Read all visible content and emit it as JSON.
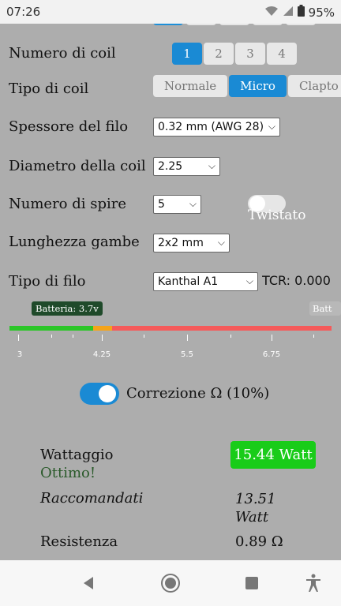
{
  "status": {
    "time": "07:26",
    "battery": "95%"
  },
  "coil_count": {
    "label": "Numero di coil",
    "options": [
      "1",
      "2",
      "3",
      "4"
    ],
    "selected": "1"
  },
  "coil_type": {
    "label": "Tipo di coil",
    "options": [
      "Normale",
      "Micro",
      "Clapto"
    ],
    "selected": "Micro"
  },
  "wire_thickness": {
    "label": "Spessore del filo",
    "value": "0.32 mm (AWG 28)"
  },
  "coil_diameter": {
    "label": "Diametro della coil",
    "value": "2.25"
  },
  "turns": {
    "label": "Numero di spire",
    "value": "5",
    "twisted_label": "Twistato"
  },
  "leg_length": {
    "label": "Lunghezza gambe",
    "value": "2x2 mm"
  },
  "wire_type": {
    "label": "Tipo di filo",
    "value": "Kanthal A1",
    "tcr": "TCR: 0.000"
  },
  "battery_slider": {
    "tag": "Batteria: 3.7v",
    "tag_right": "Batt",
    "tick_labels": [
      "3",
      "4.25",
      "5.5",
      "6.75"
    ],
    "colors": {
      "green": "#2bc628",
      "orange": "#f5a41a",
      "red": "#f55a5a"
    }
  },
  "correction": {
    "label": "Correzione Ω (10%)",
    "enabled": true
  },
  "results": {
    "wattage_label": "Wattaggio",
    "wattage_value": "15.44 Watt",
    "wattage_status": "Ottimo!",
    "recommended_label": "Raccomandati",
    "recommended_value_1": "13.51",
    "recommended_value_2": "Watt",
    "resistance_label": "Resistenza",
    "resistance_value": "0.89 Ω"
  },
  "accent": "#1a8ad4"
}
